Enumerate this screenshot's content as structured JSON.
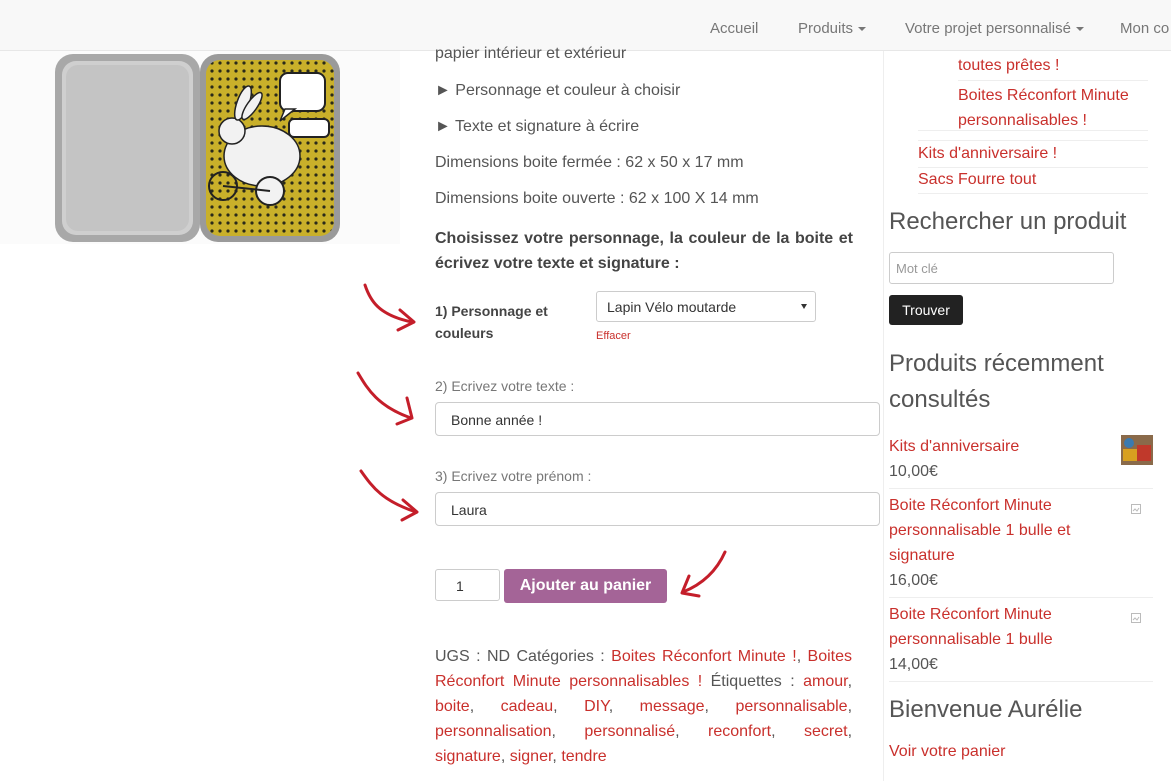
{
  "nav": {
    "items": [
      "Accueil",
      "Produits",
      "Votre projet personnalisé",
      "Mon co"
    ]
  },
  "product": {
    "lines": [
      "papier intérieur et extérieur",
      "► Personnage et couleur à choisir",
      "► Texte et signature à écrire",
      "Dimensions boite fermée : 62 x 50 x 17 mm",
      "Dimensions boite ouverte : 62 x 100 X 14 mm"
    ],
    "choose_text": "Choisissez votre personnage, la couleur de la boite et écrivez votre texte et signature :",
    "field1_label": "1) Personnage et couleurs",
    "field1_value": "Lapin Vélo moutarde",
    "clear_link": "Effacer",
    "field2_label": "2) Ecrivez votre texte :",
    "field2_value": "Bonne année !",
    "field3_label": "3) Ecrivez votre prénom :",
    "field3_value": "Laura",
    "quantity": "1",
    "add_to_cart": "Ajouter au panier",
    "meta": {
      "sku_label": "UGS : ND",
      "categories_label": "Catégories :",
      "categories": [
        "Boites Réconfort Minute !",
        "Boites Réconfort Minute personnalisables !"
      ],
      "tags_label": "Étiquettes :",
      "tags": [
        "amour",
        "boite",
        "cadeau",
        "DIY",
        "message",
        "personnalisable",
        "personnalisation",
        "personnalisé",
        "reconfort",
        "secret",
        "signature",
        "signer",
        "tendre"
      ]
    }
  },
  "sidebar": {
    "cat_links": [
      "toutes prêtes !",
      "Boites Réconfort Minute personnalisables !",
      "Kits d'anniversaire !",
      "Sacs Fourre tout"
    ],
    "search_heading": "Rechercher un produit",
    "search_placeholder": "Mot clé",
    "search_button": "Trouver",
    "recent_heading": "Produits récemment consultés",
    "recent": [
      {
        "title": "Kits d'anniversaire",
        "price": "10,00€"
      },
      {
        "title": "Boite Réconfort Minute personnalisable 1 bulle et signature",
        "price": "16,00€"
      },
      {
        "title": "Boite Réconfort Minute personnalisable 1 bulle",
        "price": "14,00€"
      }
    ],
    "welcome_heading": "Bienvenue Aurélie",
    "cart_link": "Voir votre panier"
  },
  "colors": {
    "accent": "#c9302c",
    "cart_button": "#a46497",
    "annotation_arrow": "#c41e2a"
  }
}
